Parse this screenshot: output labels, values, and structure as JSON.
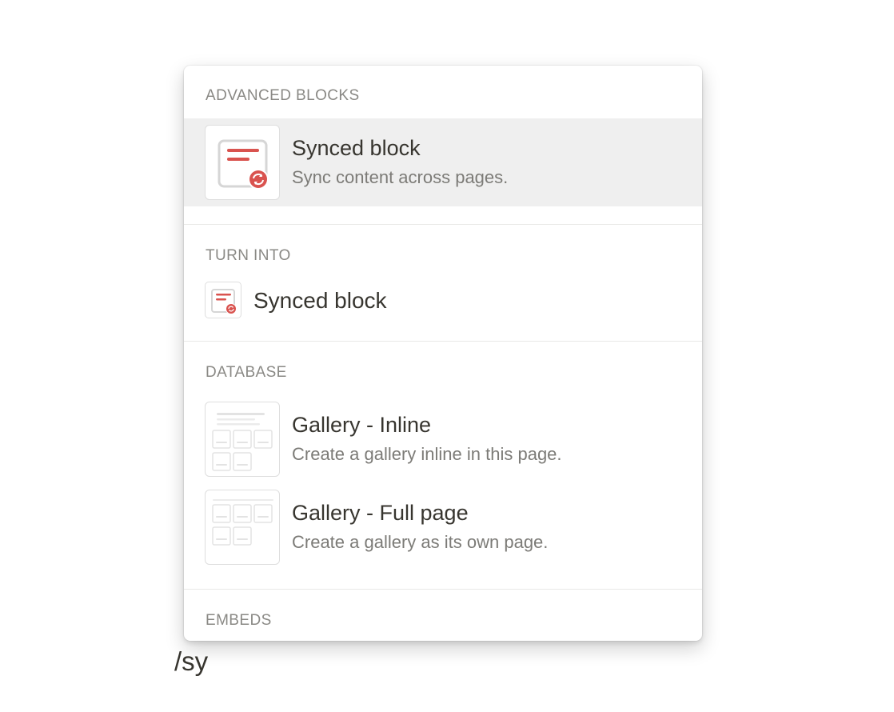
{
  "menu": {
    "sections": {
      "advanced": {
        "header": "ADVANCED BLOCKS",
        "items": [
          {
            "title": "Synced block",
            "description": "Sync content across pages.",
            "icon": "synced-block-icon"
          }
        ]
      },
      "turn_into": {
        "header": "TURN INTO",
        "items": [
          {
            "title": "Synced block",
            "icon": "synced-block-icon"
          }
        ]
      },
      "database": {
        "header": "DATABASE",
        "items": [
          {
            "title": "Gallery - Inline",
            "description": "Create a gallery inline in this page.",
            "icon": "gallery-inline-icon"
          },
          {
            "title": "Gallery - Full page",
            "description": "Create a gallery as its own page.",
            "icon": "gallery-full-page-icon"
          }
        ]
      },
      "embeds": {
        "header": "EMBEDS"
      }
    }
  },
  "editor": {
    "typed_text": "/sy"
  },
  "colors": {
    "accent_red": "#d9534f",
    "selected_bg": "#efefef",
    "header_text": "#8a8985"
  }
}
